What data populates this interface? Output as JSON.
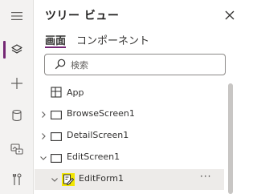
{
  "panel": {
    "title": "ツリー ビュー",
    "tabs": [
      {
        "label": "画面",
        "active": true
      },
      {
        "label": "コンポーネント",
        "active": false
      }
    ],
    "search": {
      "placeholder": "検索",
      "value": ""
    }
  },
  "rail": {
    "items": [
      {
        "icon": "hamburger-menu-icon",
        "active": false
      },
      {
        "icon": "layers-icon",
        "active": true
      },
      {
        "icon": "plus-icon",
        "active": false
      },
      {
        "icon": "database-icon",
        "active": false
      },
      {
        "icon": "media-icon",
        "active": false
      },
      {
        "icon": "tools-icon",
        "active": false
      }
    ]
  },
  "tree": {
    "app": {
      "label": "App",
      "icon": "app-icon"
    },
    "items": [
      {
        "label": "BrowseScreen1",
        "expanded": false,
        "icon": "screen-icon"
      },
      {
        "label": "DetailScreen1",
        "expanded": false,
        "icon": "screen-icon"
      },
      {
        "label": "EditScreen1",
        "expanded": true,
        "icon": "screen-icon"
      },
      {
        "label": "EditForm1",
        "expanded": true,
        "icon": "edit-form-icon",
        "selected": true,
        "more": "···"
      }
    ]
  },
  "colors": {
    "accent": "#742774",
    "rail_bg": "#f3f2f1",
    "selected_bg": "#edebe9",
    "highlight": "#f2e600"
  }
}
